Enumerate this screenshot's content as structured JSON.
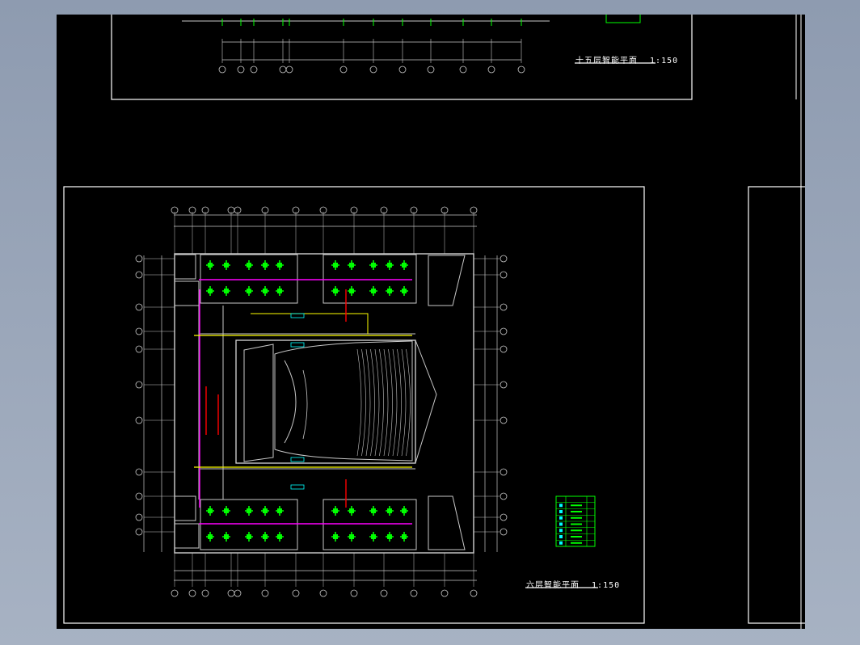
{
  "colors": {
    "background": "#000000",
    "frame": "#ffffff",
    "wall": "#c8c8c8",
    "fixture": "#00ff00",
    "pipe_red": "#ff0000",
    "pipe_magenta": "#ff00ff",
    "pipe_yellow": "#ffff00",
    "accent_cyan": "#00ffff"
  },
  "upper_sheet": {
    "title": "十五层智能平面",
    "scale": "1:150"
  },
  "lower_sheet": {
    "title": "六层智能平面",
    "scale": "1:150"
  },
  "legend": {
    "rows": 8
  }
}
